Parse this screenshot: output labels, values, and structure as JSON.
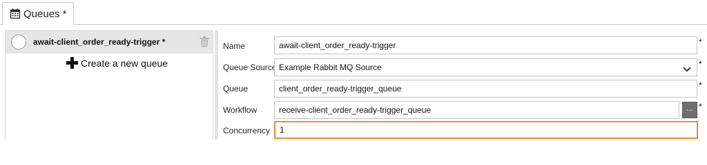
{
  "tabs": [
    {
      "label": "Queues *",
      "icon": "calendar-icon"
    }
  ],
  "queue_list": {
    "items": [
      {
        "name": "await-client_order_ready-trigger *"
      }
    ],
    "create_label": "Create a new queue"
  },
  "form": {
    "name": {
      "label": "Name",
      "value": "await-client_order_ready-trigger",
      "required_mark": "*"
    },
    "queue_source": {
      "label": "Queue Source",
      "value": "Example Rabbit MQ Source",
      "required_mark": "*"
    },
    "queue": {
      "label": "Queue",
      "value": "client_order_ready-trigger_queue",
      "required_mark": "*"
    },
    "workflow": {
      "label": "Workflow",
      "value": "receive-client_order_ready-trigger_queue",
      "required_mark": "*",
      "browse_label": "..."
    },
    "concurrency": {
      "label": "Concurrency",
      "value": "1"
    }
  },
  "colors": {
    "focus_border": "#f0892f",
    "selected_item_bg": "#e6e6e6"
  }
}
